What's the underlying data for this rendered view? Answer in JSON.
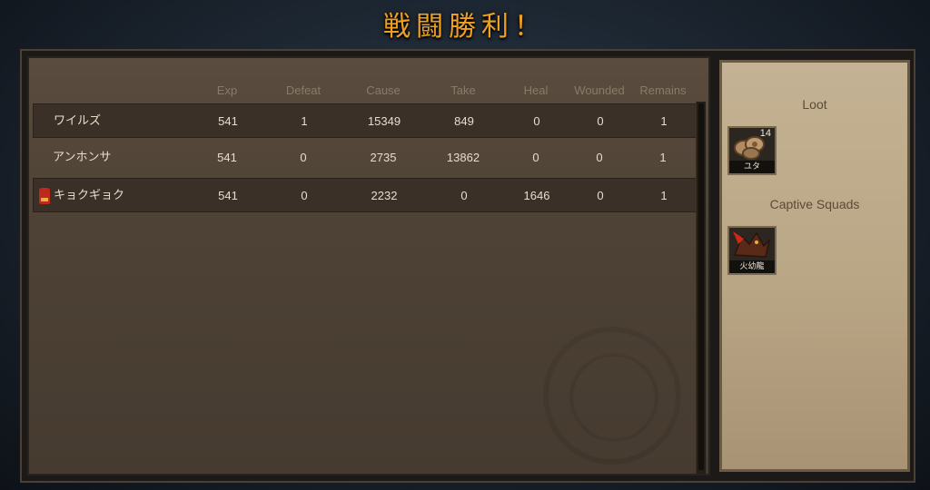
{
  "title": "戦闘勝利！",
  "table": {
    "columns": [
      "Exp",
      "Defeat",
      "Cause",
      "Take",
      "Heal",
      "Wounded",
      "Remains"
    ],
    "rows": [
      {
        "name": "ワイルズ",
        "exp": "541",
        "defeat": "1",
        "cause": "15349",
        "take": "849",
        "heal": "0",
        "wounded": "0",
        "remains": "1",
        "leader": false
      },
      {
        "name": "アンホンサ",
        "exp": "541",
        "defeat": "0",
        "cause": "2735",
        "take": "13862",
        "heal": "0",
        "wounded": "0",
        "remains": "1",
        "leader": false
      },
      {
        "name": "キョクギョク",
        "exp": "541",
        "defeat": "0",
        "cause": "2232",
        "take": "0",
        "heal": "1646",
        "wounded": "0",
        "remains": "1",
        "leader": true
      }
    ]
  },
  "side": {
    "loot_title": "Loot",
    "loot_items": [
      {
        "label": "ユタ",
        "count": "14",
        "icon": "coins-icon"
      }
    ],
    "captive_title": "Captive Squads",
    "captive_items": [
      {
        "label": "火幼龍",
        "icon": "fire-dragon-icon"
      }
    ]
  },
  "colors": {
    "title": "#f0a020",
    "panel_dark": "#463b30",
    "panel_light": "#c4b294"
  }
}
